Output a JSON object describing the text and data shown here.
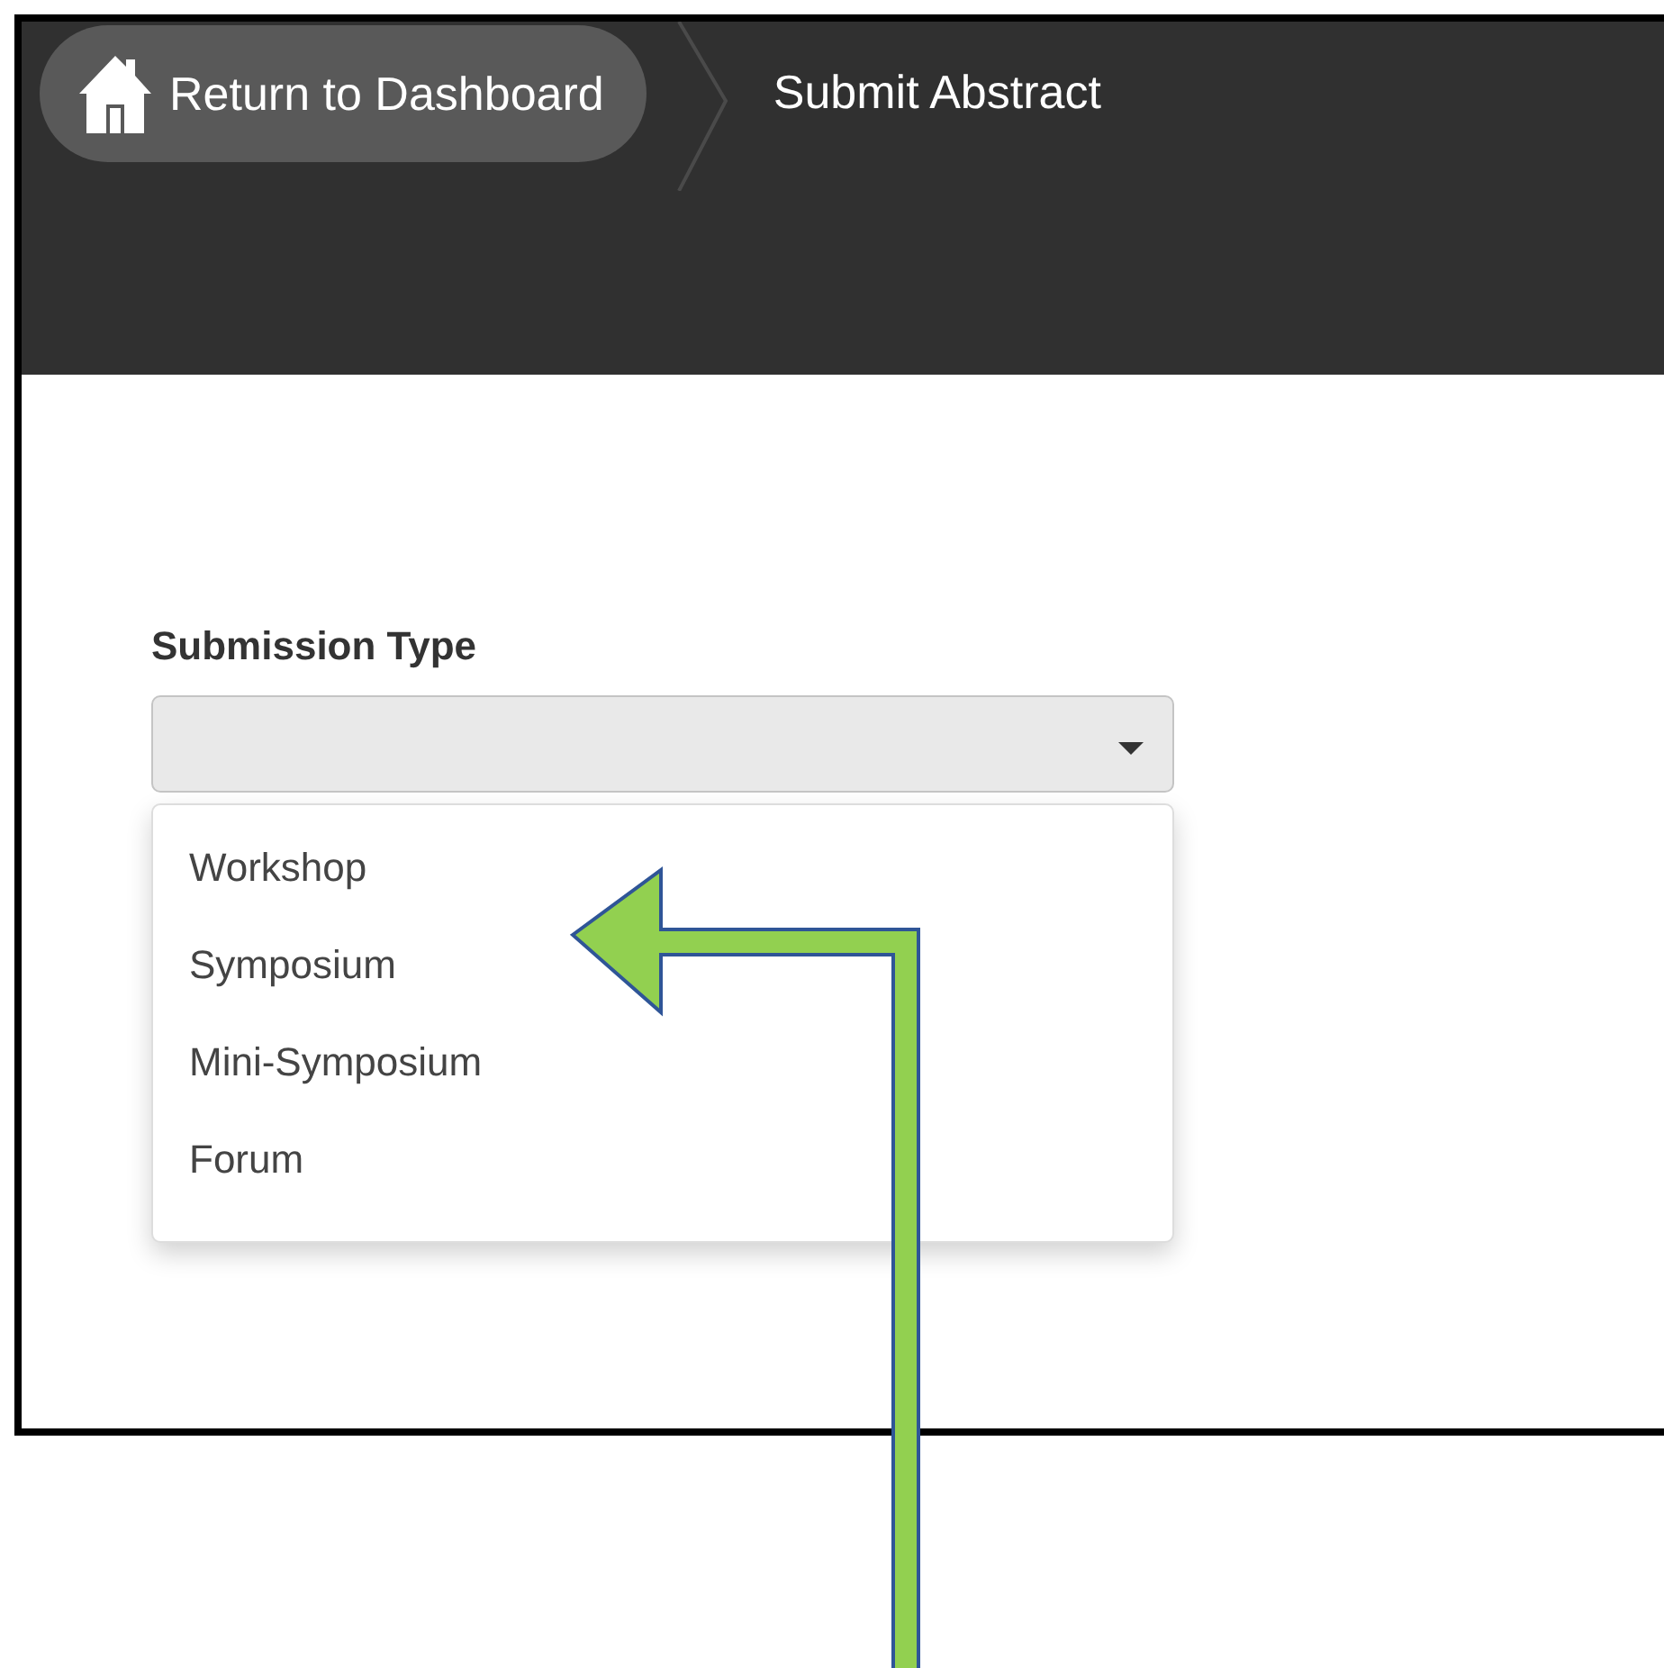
{
  "breadcrumb": [
    {
      "kind": "home",
      "label": "Return to Dashboard"
    },
    {
      "kind": "current",
      "label": "Submit Abstract"
    }
  ],
  "field": {
    "label": "Submission Type",
    "expanded": true,
    "options": [
      {
        "label": "Workshop",
        "selected": false
      },
      {
        "label": "Symposium",
        "selected": false
      },
      {
        "label": "Mini-Symposium",
        "selected": false
      },
      {
        "label": "Forum",
        "selected": false
      }
    ]
  },
  "annotation": {
    "kind": "arrow"
  }
}
